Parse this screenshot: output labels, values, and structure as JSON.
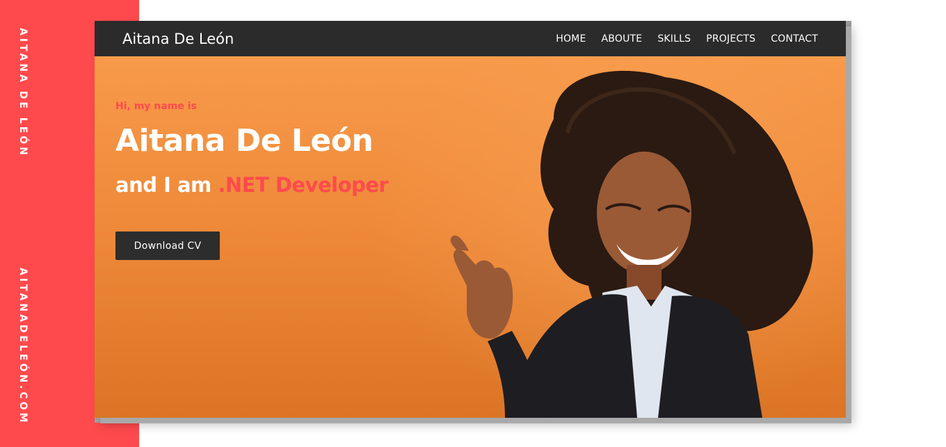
{
  "side": {
    "top_text": "AITANA DE LEÓN",
    "bottom_text": "AITANADELEÓN.COM"
  },
  "navbar": {
    "brand": "Aitana De León",
    "items": [
      {
        "label": "HOME"
      },
      {
        "label": "ABOUTE"
      },
      {
        "label": "SKILLS"
      },
      {
        "label": "PROJECTS"
      },
      {
        "label": "CONTACT"
      }
    ]
  },
  "hero": {
    "greeting": "Hi, my name is",
    "name": "Aitana De León",
    "role_prefix": "and I am ",
    "role": ".NET Developer",
    "cta_label": "Download CV"
  },
  "colors": {
    "accent": "#ff4a4d",
    "hero_orange": "#f08c3c",
    "navbar": "#2b2b2b"
  }
}
